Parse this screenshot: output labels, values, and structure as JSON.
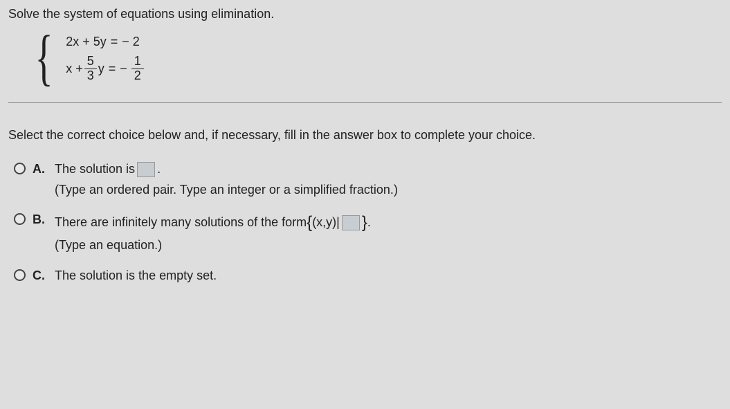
{
  "question": "Solve the system of equations using elimination.",
  "system": {
    "eq1": {
      "left": "2x + 5y",
      "equals": "=",
      "right": "− 2"
    },
    "eq2": {
      "x": "x +",
      "coef_num": "5",
      "coef_den": "3",
      "yvar": "y",
      "equals": "=",
      "neg": "−",
      "rhs_num": "1",
      "rhs_den": "2"
    }
  },
  "instruction": "Select the correct choice below and, if necessary, fill in the answer box to complete your choice.",
  "choices": {
    "a": {
      "letter": "A.",
      "line1_pre": "The solution is ",
      "line1_post": ".",
      "hint": "(Type an ordered pair. Type an integer or a simplified fraction.)"
    },
    "b": {
      "letter": "B.",
      "line1_pre": "There are infinitely many solutions of the form ",
      "set_open": "{",
      "set_mid": "(x,y)|",
      "set_close": "}",
      "line1_post": ".",
      "hint": "(Type an equation.)"
    },
    "c": {
      "letter": "C.",
      "text": "The solution is the empty set."
    }
  }
}
